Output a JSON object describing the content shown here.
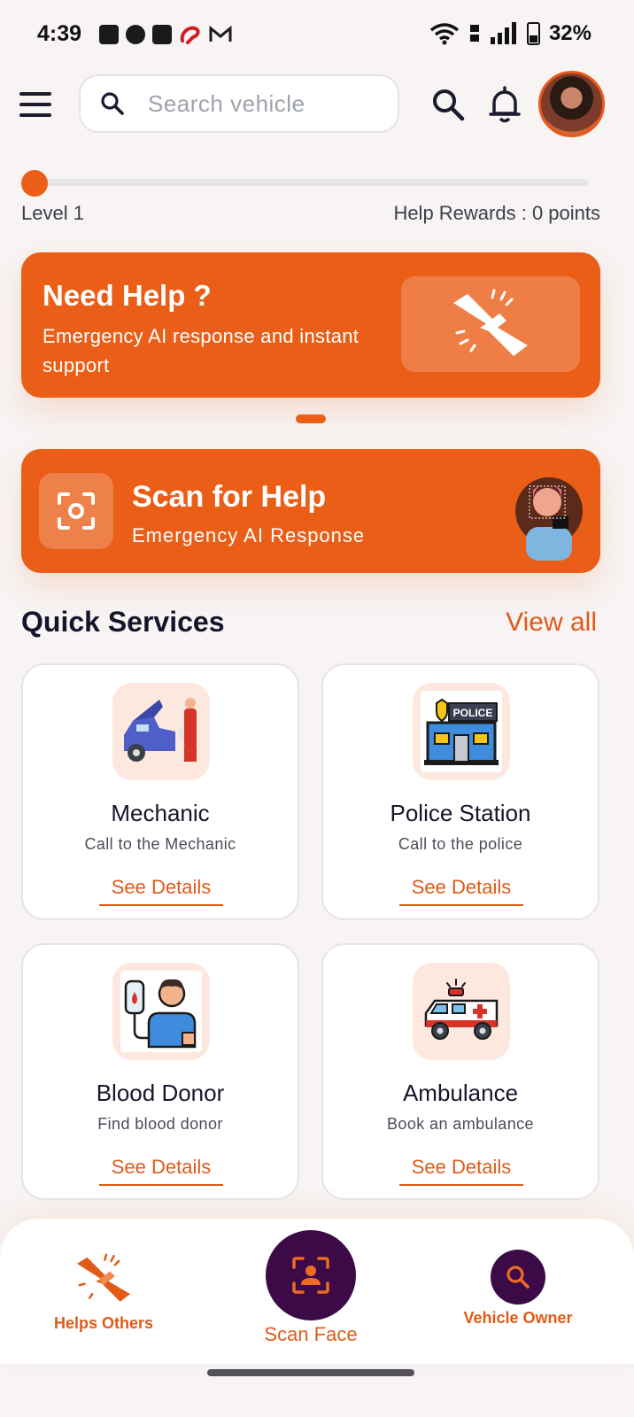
{
  "status_bar": {
    "time": "4:39",
    "battery": "32%"
  },
  "header": {
    "search_placeholder": "Search vehicle"
  },
  "level": {
    "label": "Level 1",
    "rewards": "Help Rewards : 0 points",
    "progress": 0
  },
  "help_banner": {
    "title": "Need Help ?",
    "subtitle": "Emergency AI response and instant support"
  },
  "scan_banner": {
    "title": "Scan for Help",
    "subtitle": "Emergency AI Response"
  },
  "quick_services": {
    "title": "Quick Services",
    "view_all": "View all",
    "cards": [
      {
        "title": "Mechanic",
        "subtitle": "Call to the Mechanic",
        "link": "See Details",
        "icon": "mechanic-icon"
      },
      {
        "title": "Police Station",
        "subtitle": "Call to the police",
        "link": "See Details",
        "icon": "police-station-icon"
      },
      {
        "title": "Blood Donor",
        "subtitle": "Find blood donor",
        "link": "See Details",
        "icon": "blood-donor-icon"
      },
      {
        "title": "Ambulance",
        "subtitle": "Book an ambulance",
        "link": "See Details",
        "icon": "ambulance-icon"
      }
    ],
    "police_sign": "POLICE"
  },
  "bottom_nav": {
    "helps_others": "Helps Others",
    "scan_face": "Scan Face",
    "vehicle_owner": "Vehicle Owner"
  },
  "colors": {
    "accent": "#ea5e17",
    "dark_purple": "#3c0b47",
    "background": "#f7f4f3"
  }
}
